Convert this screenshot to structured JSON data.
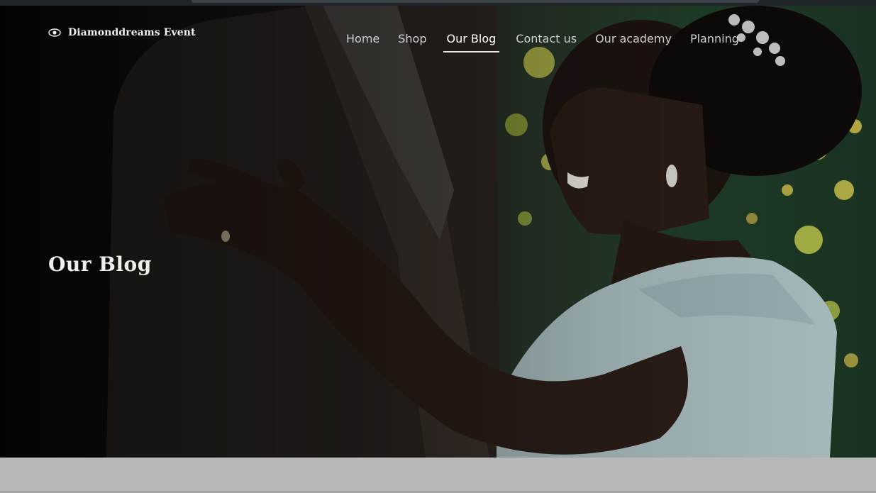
{
  "brand": {
    "name": "Diamonddreams Event",
    "logo_icon": "eye-logo-icon"
  },
  "nav": {
    "items": [
      {
        "label": "Home",
        "active": false
      },
      {
        "label": "Shop",
        "active": false
      },
      {
        "label": "Our Blog",
        "active": true
      },
      {
        "label": "Contact us",
        "active": false
      },
      {
        "label": "Our academy",
        "active": false
      },
      {
        "label": "Planning",
        "active": false
      }
    ]
  },
  "hero": {
    "title": "Our Blog"
  },
  "colors": {
    "accent_underline": "#e8e8e8",
    "nav_text": "#cfcfcf",
    "below_band": "#b8b8b8"
  }
}
